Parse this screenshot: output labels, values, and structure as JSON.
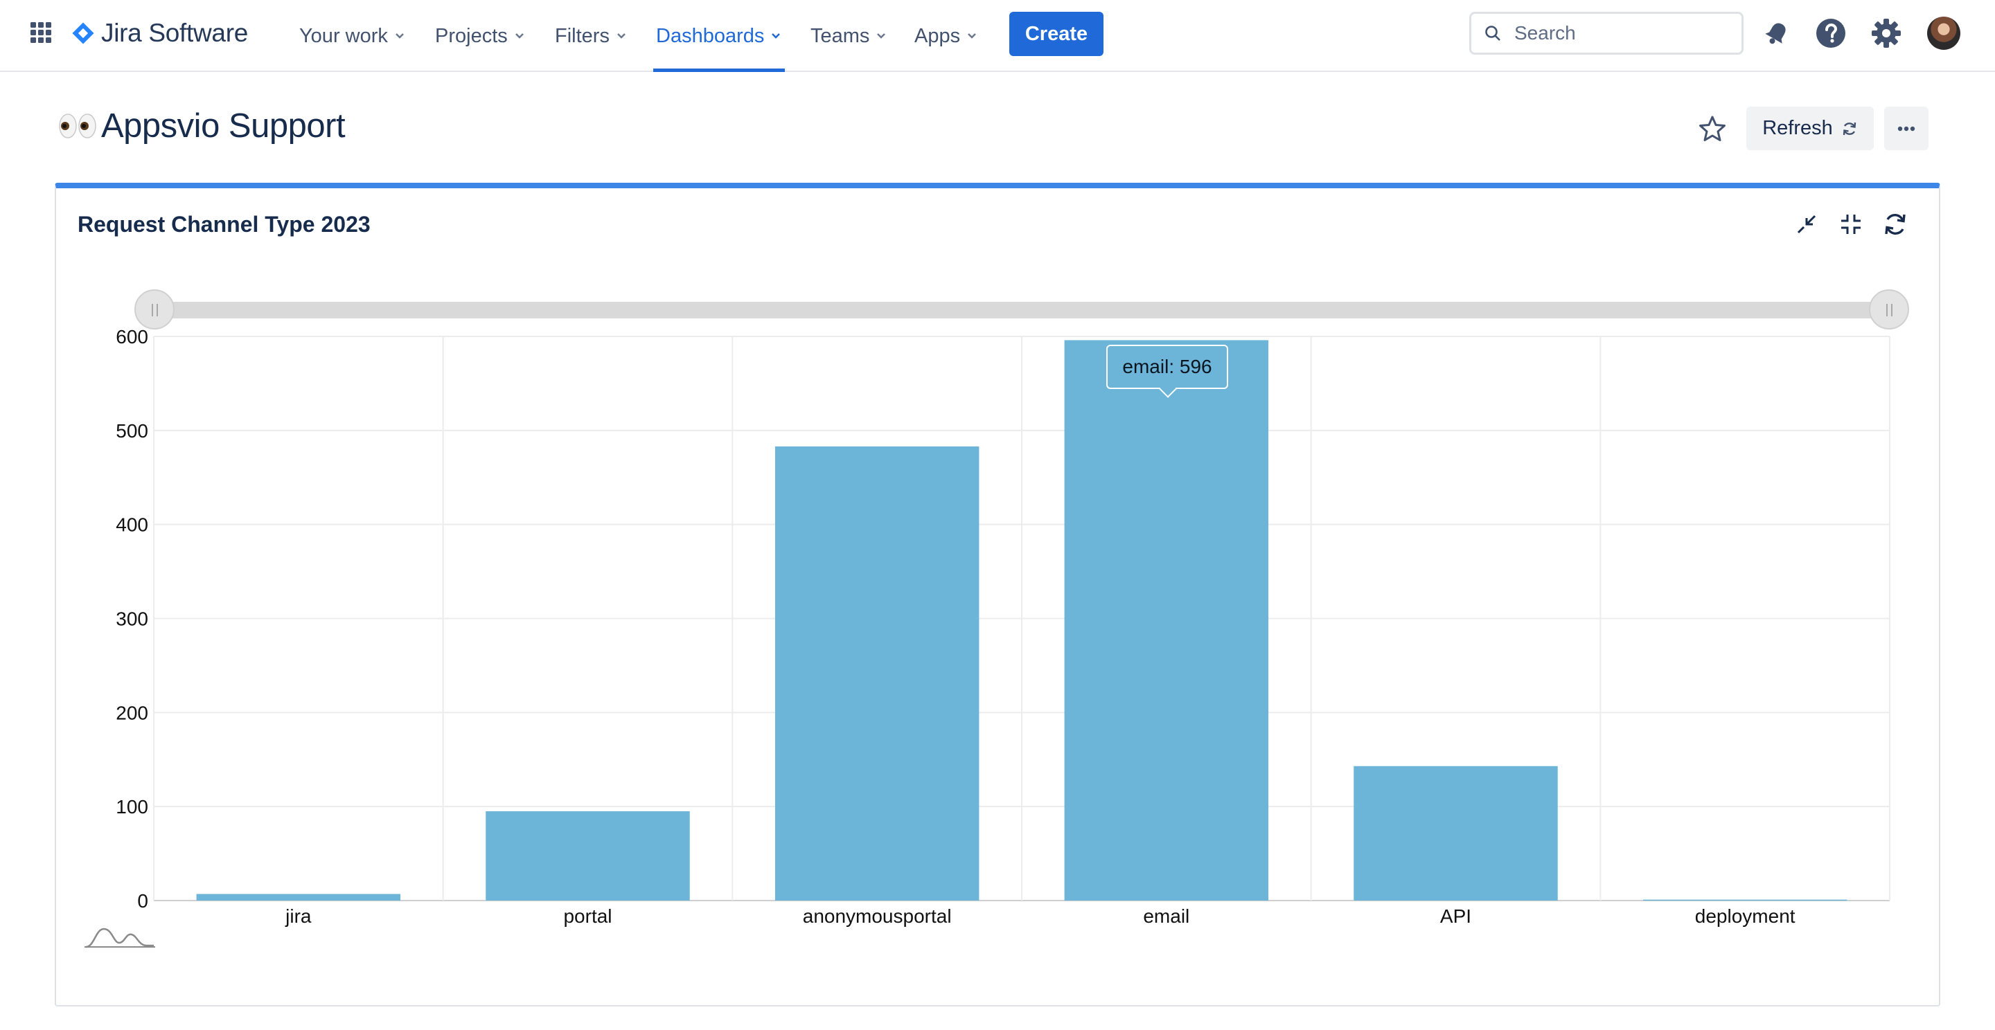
{
  "nav": {
    "logo_text": "Jira Software",
    "items": [
      {
        "label": "Your work"
      },
      {
        "label": "Projects"
      },
      {
        "label": "Filters"
      },
      {
        "label": "Dashboards"
      },
      {
        "label": "Teams"
      },
      {
        "label": "Apps"
      }
    ],
    "active_item": "Dashboards",
    "create_label": "Create",
    "search_placeholder": "Search",
    "icons": [
      "app-switcher-icon",
      "notifications-icon",
      "help-icon",
      "settings-icon",
      "avatar"
    ]
  },
  "page": {
    "title_emoji": "👀",
    "title": "Appsvio Support",
    "refresh_label": "Refresh",
    "icons": [
      "star-icon",
      "refresh-icon",
      "more-icon"
    ]
  },
  "gadget": {
    "title": "Request Channel Type 2023",
    "icons": [
      "minimize-icon",
      "collapse-icon",
      "gadget-refresh-icon"
    ],
    "tooltip": "email: 596"
  },
  "colors": {
    "accent": "#1f6ad8",
    "gadget_border": "#3b86e6",
    "bar": "#6cb5d8"
  },
  "chart_data": {
    "type": "bar",
    "categories": [
      "jira",
      "portal",
      "anonymousportal",
      "email",
      "API",
      "deployment"
    ],
    "values": [
      7,
      95,
      483,
      596,
      143,
      1
    ],
    "title": "Request Channel Type 2023",
    "xlabel": "",
    "ylabel": "",
    "ylim": [
      0,
      600
    ],
    "yticks": [
      0,
      100,
      200,
      300,
      400,
      500,
      600
    ],
    "grid": true,
    "legend": "none",
    "zoom_slider": true
  }
}
